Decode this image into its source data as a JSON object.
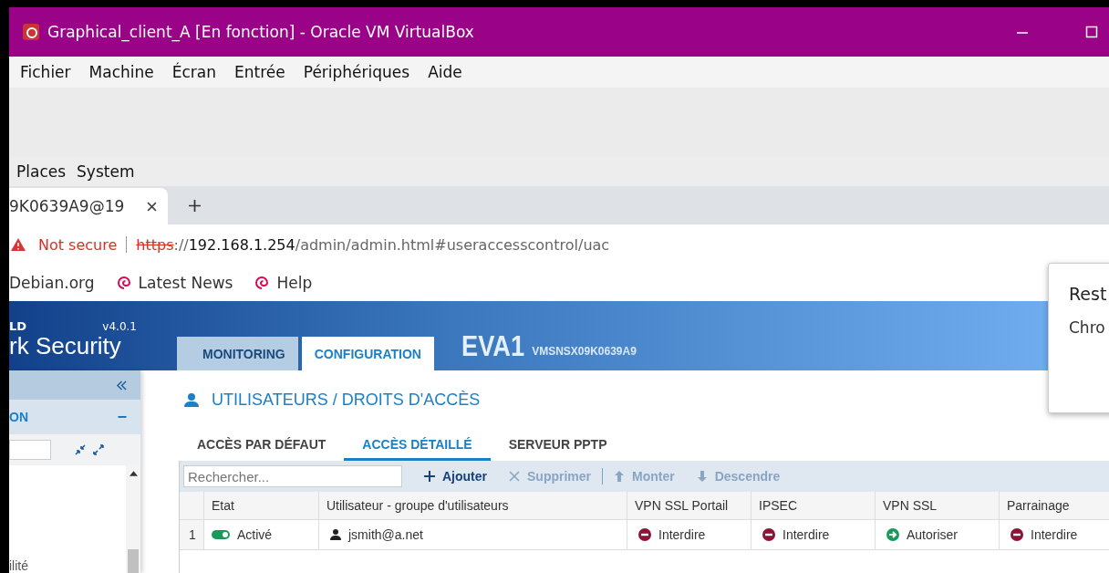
{
  "window": {
    "title": "Graphical_client_A [En fonction] - Oracle VM VirtualBox"
  },
  "menu": [
    "Fichier",
    "Machine",
    "Écran",
    "Entrée",
    "Périphériques",
    "Aide"
  ],
  "desktop_menu": [
    "Places",
    "System"
  ],
  "browser_tab": {
    "title": "9K0639A9@19"
  },
  "address_bar": {
    "security": "Not secure",
    "scheme": "https",
    "separator": "://",
    "host": "192.168.1.254",
    "path": "/admin/admin.html#useraccesscontrol/uac"
  },
  "bookmarks": [
    "Debian.org",
    "Latest News",
    "Help"
  ],
  "app": {
    "brand_top": "LD",
    "brand_name": "rk Security",
    "version": "v4.0.1",
    "tabs": [
      {
        "label": "MONITORING",
        "selected": false
      },
      {
        "label": "CONFIGURATION",
        "selected": true
      }
    ],
    "device_name": "EVA1",
    "device_serial": "VMSNSX09K0639A9"
  },
  "sidebar": {
    "section": "ON",
    "item": "ilité"
  },
  "page_title": "UTILISATEURS / DROITS D'ACCÈS",
  "subtabs": [
    {
      "label": "ACCÈS PAR DÉFAUT",
      "selected": false
    },
    {
      "label": "ACCÈS DÉTAILLÉ",
      "selected": true
    },
    {
      "label": "SERVEUR PPTP",
      "selected": false
    }
  ],
  "toolbar": {
    "search_placeholder": "Rechercher...",
    "buttons": [
      {
        "label": "Ajouter",
        "kind": "add",
        "disabled": false
      },
      {
        "label": "Supprimer",
        "kind": "delete",
        "disabled": true
      },
      {
        "label": "Monter",
        "kind": "up",
        "disabled": true
      },
      {
        "label": "Descendre",
        "kind": "down",
        "disabled": true
      }
    ]
  },
  "table": {
    "columns": [
      "Etat",
      "Utilisateur - groupe d'utilisateurs",
      "VPN SSL Portail",
      "IPSEC",
      "VPN SSL",
      "Parrainage"
    ],
    "rows": [
      {
        "index": "1",
        "status": {
          "label": "Activé",
          "on": true
        },
        "user": "jsmith@a.net",
        "rules": [
          {
            "label": "Interdire",
            "kind": "deny"
          },
          {
            "label": "Interdire",
            "kind": "deny"
          },
          {
            "label": "Autoriser",
            "kind": "allow"
          },
          {
            "label": "Interdire",
            "kind": "deny"
          }
        ]
      }
    ]
  },
  "popup": {
    "title": "Rest",
    "text": "Chro"
  }
}
